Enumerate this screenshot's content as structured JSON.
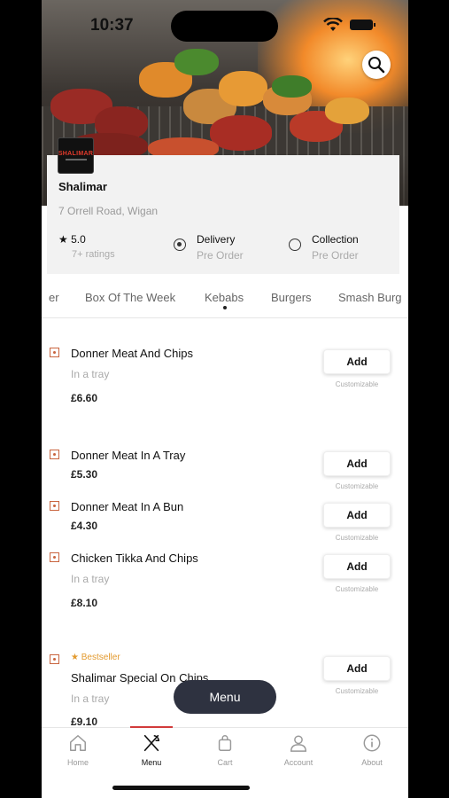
{
  "status": {
    "time": "10:37"
  },
  "restaurant": {
    "logo_text": "SHALIMAR",
    "name": "Shalimar",
    "address": "7 Orrell Road, Wigan",
    "rating": "5.0",
    "ratings_count": "7+ ratings"
  },
  "order_options": [
    {
      "title": "Delivery",
      "subtitle": "Pre Order",
      "selected": true
    },
    {
      "title": "Collection",
      "subtitle": "Pre Order",
      "selected": false
    }
  ],
  "categories": [
    "er",
    "Box Of The Week",
    "Kebabs",
    "Burgers",
    "Smash Burg"
  ],
  "items": [
    {
      "name": "Donner Meat And Chips",
      "desc": "In a tray",
      "price": "£6.60",
      "add": "Add",
      "custom": "Customizable"
    },
    {
      "name": "Donner Meat In A Tray",
      "desc": "",
      "price": "£5.30",
      "add": "Add",
      "custom": "Customizable"
    },
    {
      "name": "Donner Meat In A Bun",
      "desc": "",
      "price": "£4.30",
      "add": "Add",
      "custom": "Customizable"
    },
    {
      "name": "Chicken Tikka And Chips",
      "desc": "In a tray",
      "price": "£8.10",
      "add": "Add",
      "custom": "Customizable"
    },
    {
      "badge": "Bestseller",
      "name": "Shalimar Special On Chips",
      "desc": "In a tray",
      "price": "£9.10",
      "add": "Add",
      "custom": "Customizable"
    }
  ],
  "menu_button": "Menu",
  "nav": [
    {
      "label": "Home",
      "icon": "home-icon"
    },
    {
      "label": "Menu",
      "icon": "cutlery-icon",
      "active": true
    },
    {
      "label": "Cart",
      "icon": "bag-icon"
    },
    {
      "label": "Account",
      "icon": "user-icon"
    },
    {
      "label": "About",
      "icon": "info-icon"
    }
  ],
  "colors": {
    "accent": "#d23b3b",
    "veg_marker": "#c9643e",
    "bestseller": "#e39a2e",
    "fab": "#2e3240"
  }
}
